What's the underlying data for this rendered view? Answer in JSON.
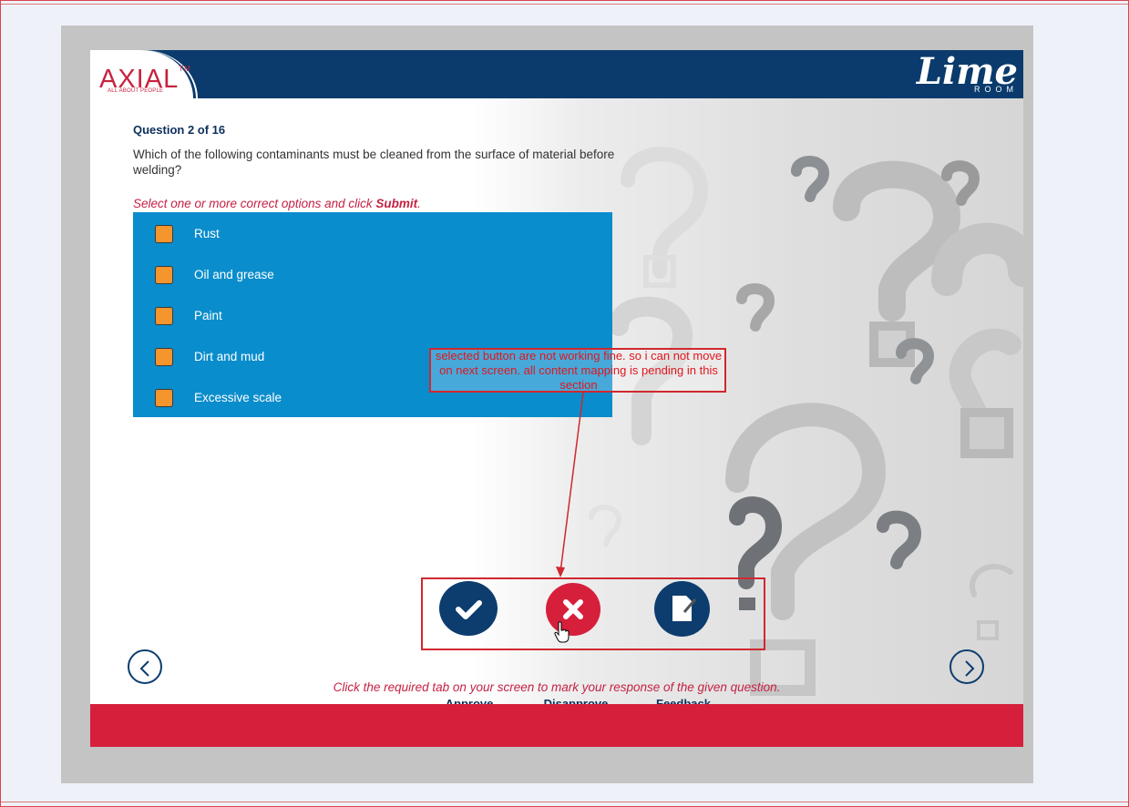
{
  "brand": {
    "left_logo_text": "AXIAL",
    "left_logo_tm": "TM",
    "left_logo_tagline": "ALL ABOUT PEOPLE",
    "right_logo_text": "Lime",
    "right_logo_sub": "ROOM"
  },
  "question": {
    "counter": "Question 2 of 16",
    "text": "Which of the following contaminants must be cleaned from the surface of material before welding?",
    "instruction_prefix": "Select one or more correct options and click ",
    "instruction_action": "Submit",
    "instruction_suffix": "."
  },
  "options": [
    {
      "label": "Rust"
    },
    {
      "label": "Oil and grease"
    },
    {
      "label": "Paint"
    },
    {
      "label": "Dirt and mud"
    },
    {
      "label": "Excessive scale"
    }
  ],
  "review_actions": [
    {
      "label": "Approve",
      "icon": "checkmark-icon",
      "color": "#0d3d6e"
    },
    {
      "label": "Disapprove",
      "icon": "x-icon",
      "color": "#d61f3b"
    },
    {
      "label": "Feedback",
      "icon": "document-pencil-icon",
      "color": "#0d3d6e"
    }
  ],
  "footer_message": "Click the required tab on your screen to mark your response of the given question.",
  "annotation": {
    "comment": "selected button are not working fine. so i can not move on next screen. all content mapping is pending in this section"
  },
  "colors": {
    "header_navy": "#0a3b6c",
    "options_blue": "#0a8dcc",
    "checkbox_orange": "#f4952d",
    "accent_red": "#d61f3b",
    "annotation_red": "#d0282f"
  }
}
